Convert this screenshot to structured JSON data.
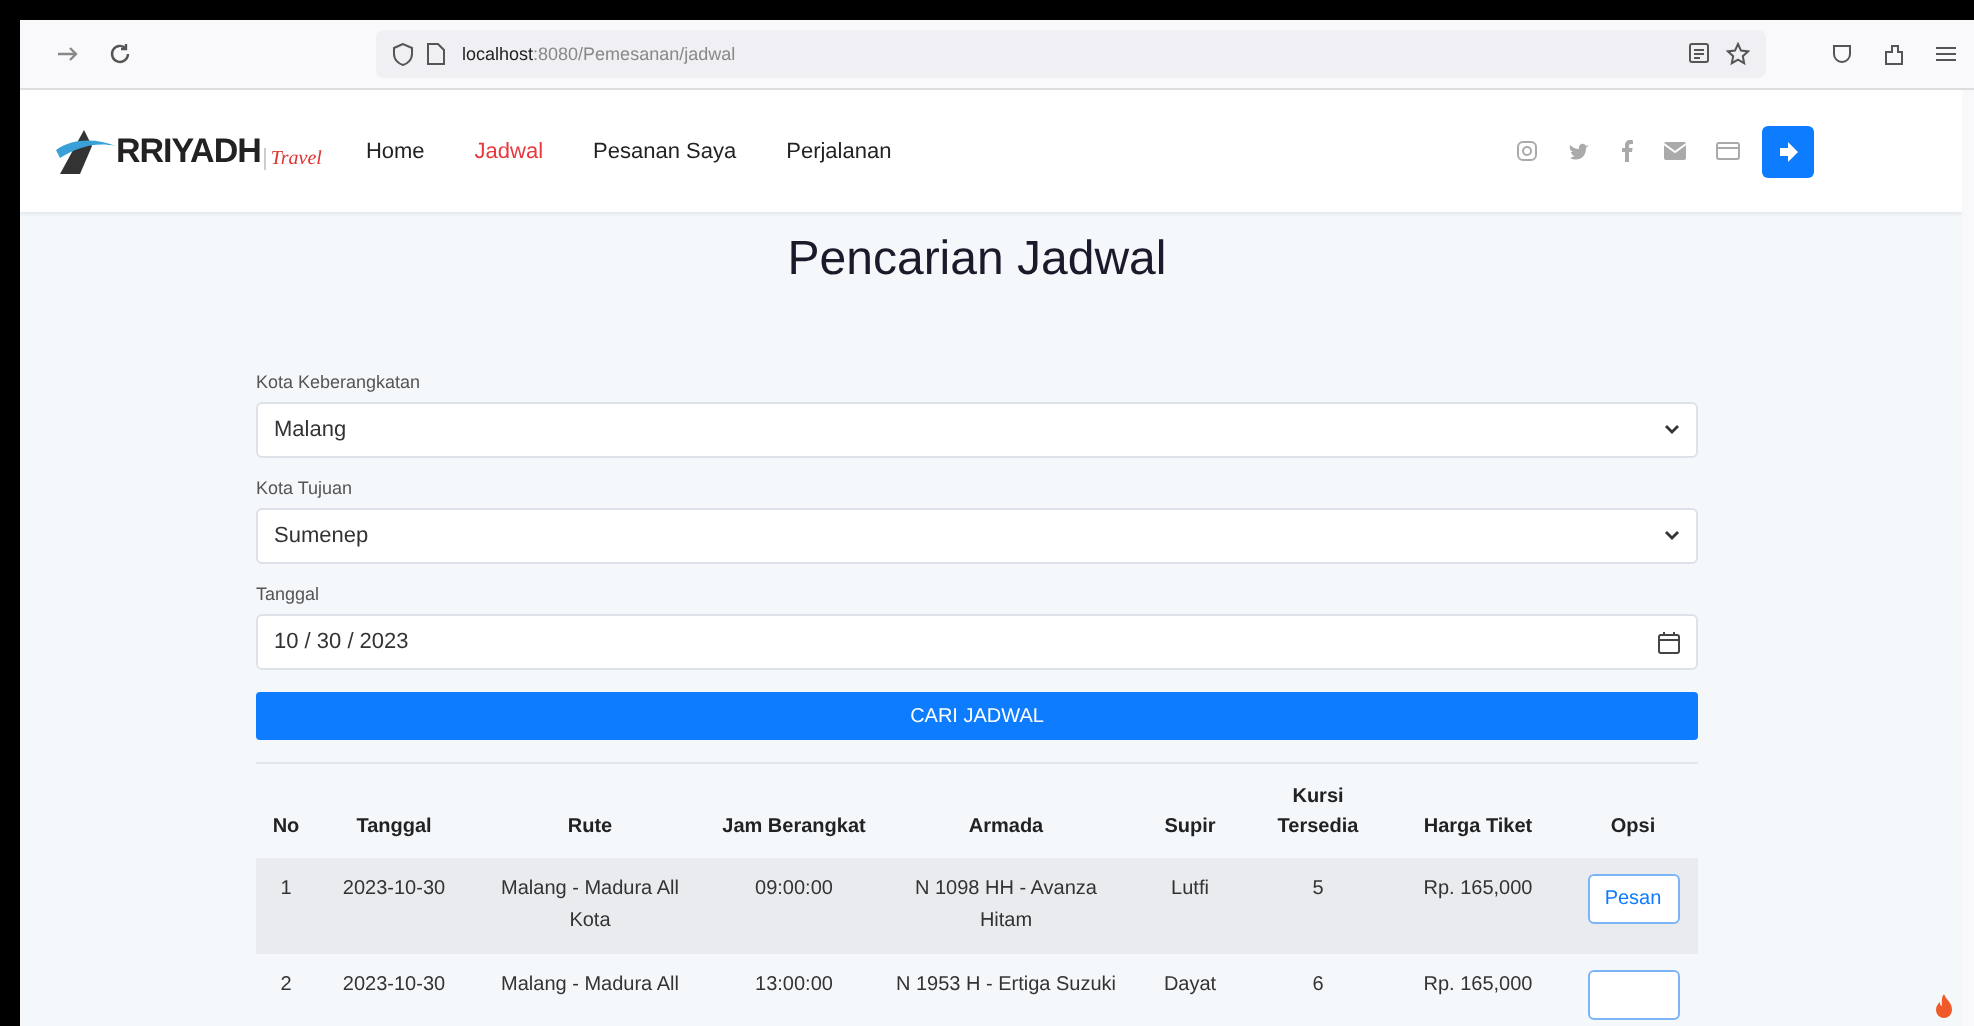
{
  "browser": {
    "url_host": "localhost",
    "url_path": ":8080/Pemesanan/jadwal"
  },
  "navbar": {
    "logo_text": "RRIYADH",
    "logo_sub": "Travel",
    "links": [
      {
        "label": "Home",
        "selected": false
      },
      {
        "label": "Jadwal",
        "selected": true
      },
      {
        "label": "Pesanan Saya",
        "selected": false
      },
      {
        "label": "Perjalanan",
        "selected": false
      }
    ]
  },
  "page_title": "Pencarian Jadwal",
  "form": {
    "fields": [
      {
        "kind": "select",
        "label": "Kota Keberangkatan",
        "value": "Malang"
      },
      {
        "kind": "select",
        "label": "Kota Tujuan",
        "value": "Sumenep"
      },
      {
        "kind": "date",
        "label": "Tanggal",
        "value": "10 / 30 / 2023"
      }
    ],
    "submit": "CARI JADWAL"
  },
  "table": {
    "columns": [
      "No",
      "Tanggal",
      "Rute",
      "Jam Berangkat",
      "Armada",
      "Supir",
      "Kursi Tersedia",
      "Harga Tiket",
      "Opsi"
    ],
    "rows": [
      {
        "cells": [
          "1",
          "2023-10-30",
          "Malang - Madura All Kota",
          "09:00:00",
          "N 1098 HH - Avanza Hitam",
          "Lutfi",
          "5",
          "Rp. 165,000"
        ],
        "action": "Pesan"
      },
      {
        "cells": [
          "2",
          "2023-10-30",
          "Malang - Madura All",
          "13:00:00",
          "N 1953 H - Ertiga Suzuki",
          "Dayat",
          "6",
          "Rp. 165,000"
        ]
      }
    ]
  }
}
